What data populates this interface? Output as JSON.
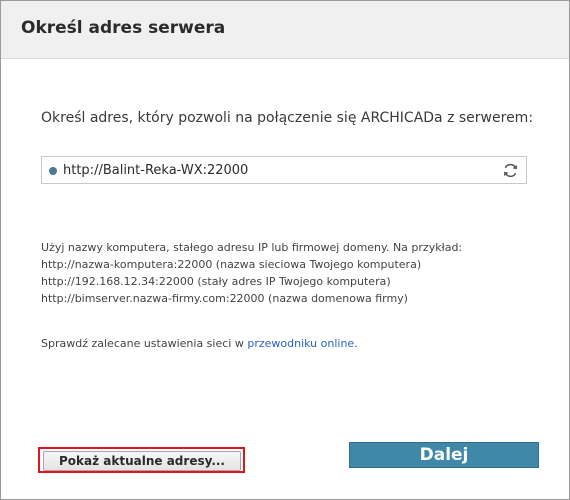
{
  "window": {
    "title": "Określ adres serwera"
  },
  "main": {
    "prompt": "Określ adres, który pozwoli na połączenie się ARCHICADa z serwerem:",
    "server_field": {
      "value": "http://Balint-Reka-WX:22000",
      "status_color": "#4a7a96",
      "refresh_icon": "refresh-icon"
    },
    "hint_lines": [
      "Użyj nazwy komputera, stałego adresu IP lub firmowej domeny. Na przykład:",
      "http://nazwa-komputera:22000 (nazwa sieciowa Twojego komputera)",
      "http://192.168.12.34:22000 (stały adres IP Twojego komputera)",
      "http://bimserver.nazwa-firmy.com:22000 (nazwa domenowa firmy)"
    ],
    "network_text": "Sprawdź zalecane ustawienia sieci w ",
    "network_link": "przewodniku online",
    "network_suffix": "."
  },
  "footer": {
    "show_addresses_label": "Pokaż aktualne adresy...",
    "next_label": "Dalej",
    "highlight_color": "#e0141c",
    "accent_color": "#3f88a8"
  }
}
